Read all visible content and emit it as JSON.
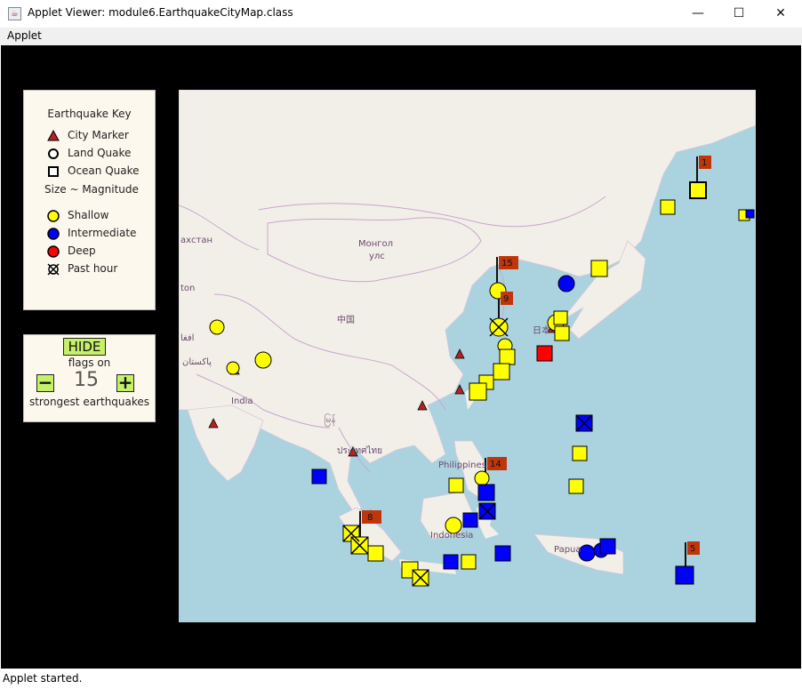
{
  "window": {
    "title": "Applet Viewer: module6.EarthquakeCityMap.class",
    "menu": "Applet",
    "status": "Applet started.",
    "minimize": "—",
    "maximize": "☐",
    "close": "✕"
  },
  "key": {
    "title": "Earthquake Key",
    "city_marker": "City Marker",
    "land_quake": "Land Quake",
    "ocean_quake": "Ocean Quake",
    "size_note": "Size ~ Magnitude",
    "shallow": "Shallow",
    "intermediate": "Intermediate",
    "deep": "Deep",
    "past_hour": "Past hour"
  },
  "controls": {
    "hide_label": "HIDE",
    "flags_on": "flags on",
    "minus": "−",
    "plus": "+",
    "count": "15",
    "strongest": "strongest earthquakes"
  },
  "map_labels": {
    "kazakhstan": "ахстан",
    "mongolia_1": "Монгол",
    "mongolia_2": "улс",
    "china": "中国",
    "afghanistan": "ton",
    "pakistan": "پاکستان",
    "iran": "افغا",
    "india": "India",
    "thailand": "ประเทศไทย",
    "myanmar": "မြန်",
    "japan": "日本",
    "philippines": "Philippines",
    "indonesia": "Indonesia",
    "papua": "Papua"
  },
  "colors": {
    "shallow": "#ffff00",
    "intermediate": "#0000ff",
    "deep": "#ff0000",
    "city": "#b22222",
    "flag": "#c0360c",
    "button": "#c6f06a",
    "water": "#aad3df",
    "land": "#f2efe9"
  },
  "flags": [
    "1",
    "15",
    "9",
    "14",
    "8",
    "5"
  ]
}
